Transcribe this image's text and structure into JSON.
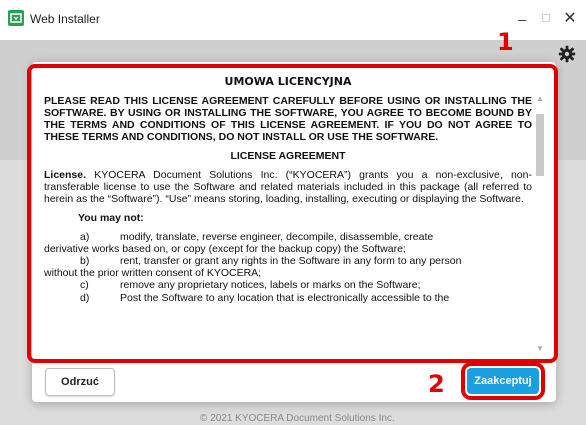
{
  "window": {
    "title": "Web Installer",
    "minimize": "–",
    "maximize": "☐",
    "close": "✕"
  },
  "callouts": {
    "one": "1",
    "two": "2"
  },
  "license": {
    "heading": "UMOWA LICENCYJNA",
    "intro": "PLEASE READ THIS LICENSE AGREEMENT CAREFULLY BEFORE USING OR INSTALLING THE SOFTWARE. BY USING OR INSTALLING THE SOFTWARE, YOU AGREE TO BECOME BOUND BY THE TERMS AND CONDITIONS OF THIS LICENSE AGREEMENT. IF YOU DO NOT AGREE TO THESE TERMS AND CONDITIONS, DO NOT INSTALL OR USE THE SOFTWARE.",
    "subheading": "LICENSE AGREEMENT",
    "license_label": "License.",
    "license_text": " KYOCERA Document Solutions Inc. (“KYOCERA”) grants you a non-exclusive, non-transferable license to use the Software and related materials included in this package (all referred to herein as the “Software”). “Use” means storing, loading, installing, executing or displaying the Software.",
    "you_may_not": "You may not:",
    "items": [
      {
        "label": "a)",
        "text": "modify, translate, reverse engineer, decompile, disassemble, create",
        "cont": "derivative works based on, or copy (except for the backup copy) the Software;"
      },
      {
        "label": "b)",
        "text": "rent, transfer or grant any rights in the Software in any form to any person",
        "cont": "without the prior written consent of KYOCERA;"
      },
      {
        "label": "c)",
        "text": "remove any proprietary notices, labels or marks on the Software;",
        "cont": ""
      },
      {
        "label": "d)",
        "text": "Post the Software to any location that is electronically accessible to the",
        "cont": ""
      }
    ]
  },
  "buttons": {
    "reject": "Odrzuć",
    "accept": "Zaakceptuj"
  },
  "footer": "© 2021 KYOCERA Document Solutions Inc.",
  "colors": {
    "accent": "#1aa0e0",
    "highlight": "#e00000",
    "app_icon": "#2e9e55"
  }
}
